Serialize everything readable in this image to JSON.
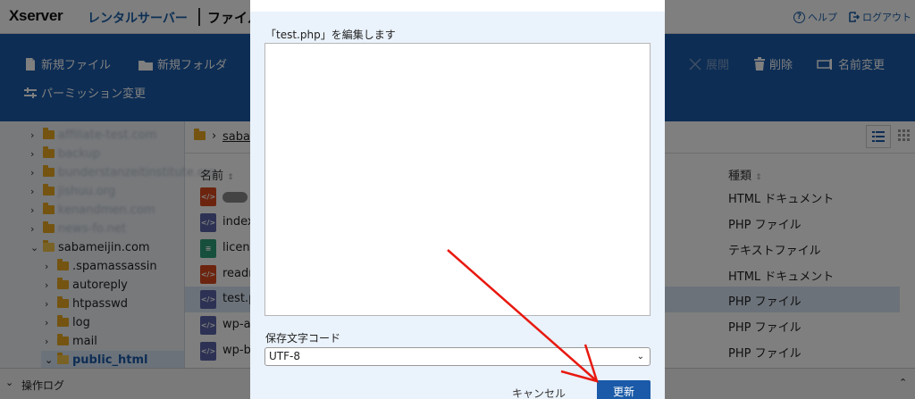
{
  "header": {
    "logo": "Xserver",
    "logo_sub": "レンタルサーバー",
    "app_title": "ファイル",
    "help": "ヘルプ",
    "logout": "ログアウト"
  },
  "toolbar": {
    "new_file": "新規ファイル",
    "new_folder": "新規フォルダ",
    "permission": "パーミッション変更",
    "extract": "展開",
    "delete": "削除",
    "rename": "名前変更"
  },
  "sidebar": {
    "blurred_items": [
      "affiliate-test.com",
      "backup",
      "bunderstanzeitinstitute.org",
      "jishuu.org",
      "kenandmen.com",
      "news-fo.net"
    ],
    "site": "sabameijin.com",
    "children": [
      ".spamassassin",
      "autoreply",
      "htpasswd",
      "log",
      "mail",
      "public_html"
    ]
  },
  "breadcrumb": {
    "path": "saba"
  },
  "file_list": {
    "col_name": "名前",
    "col_type": "種類",
    "rows": [
      {
        "name": "",
        "type": "HTML ドキュメント",
        "kind": "html"
      },
      {
        "name": "index",
        "type": "PHP ファイル",
        "kind": "php"
      },
      {
        "name": "licens",
        "type": "テキストファイル",
        "kind": "txt"
      },
      {
        "name": "readm",
        "type": "HTML ドキュメント",
        "kind": "html"
      },
      {
        "name": "test.p",
        "type": "PHP ファイル",
        "kind": "php"
      },
      {
        "name": "wp-ac",
        "type": "PHP ファイル",
        "kind": "php"
      },
      {
        "name": "wp-bl",
        "type": "PHP ファイル",
        "kind": "php"
      }
    ]
  },
  "status": {
    "log_label": "操作ログ"
  },
  "modal": {
    "title": "「test.php」を編集します",
    "editor_content": "",
    "encoding_label": "保存文字コード",
    "encoding_value": "UTF-8",
    "cancel": "キャンセル",
    "update": "更新"
  },
  "colors": {
    "brand": "#1a5aa8",
    "annotation_arrow": "#e8190f"
  }
}
